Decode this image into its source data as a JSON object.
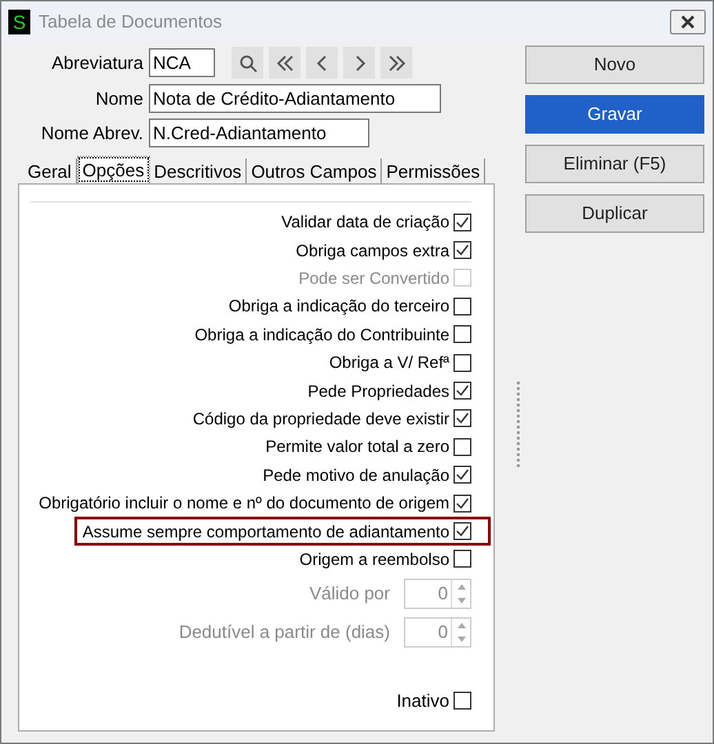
{
  "window": {
    "title": "Tabela de Documentos",
    "icon_glyph": "S"
  },
  "fields": [
    {
      "label": "Abreviatura",
      "value": "NCA",
      "kind": "short"
    },
    {
      "label": "Nome",
      "value": "Nota de Crédito-Adiantamento",
      "kind": "long"
    },
    {
      "label": "Nome Abrev.",
      "value": "N.Cred-Adiantamento",
      "kind": "medium"
    }
  ],
  "tabs": [
    {
      "label": "Geral",
      "selected": false
    },
    {
      "label": "Opções",
      "selected": true
    },
    {
      "label": "Descritivos",
      "selected": false
    },
    {
      "label": "Outros Campos",
      "selected": false
    },
    {
      "label": "Permissões",
      "selected": false
    }
  ],
  "options": [
    {
      "kind": "checkbox",
      "label": "Validar data de criação",
      "checked": true,
      "disabled": false,
      "highlighted": false
    },
    {
      "kind": "checkbox",
      "label": "Obriga campos extra",
      "checked": true,
      "disabled": false,
      "highlighted": false
    },
    {
      "kind": "checkbox",
      "label": "Pode ser Convertido",
      "checked": false,
      "disabled": true,
      "highlighted": false
    },
    {
      "kind": "checkbox",
      "label": "Obriga a indicação do terceiro",
      "checked": false,
      "disabled": false,
      "highlighted": false
    },
    {
      "kind": "checkbox",
      "label": "Obriga a indicação do Contribuinte",
      "checked": false,
      "disabled": false,
      "highlighted": false
    },
    {
      "kind": "checkbox",
      "label": "Obriga a V/ Refª",
      "checked": false,
      "disabled": false,
      "highlighted": false
    },
    {
      "kind": "checkbox",
      "label": "Pede Propriedades",
      "checked": true,
      "disabled": false,
      "highlighted": false
    },
    {
      "kind": "checkbox",
      "label": "Código da propriedade deve existir",
      "checked": true,
      "disabled": false,
      "highlighted": false
    },
    {
      "kind": "checkbox",
      "label": "Permite valor total a zero",
      "checked": false,
      "disabled": false,
      "highlighted": false
    },
    {
      "kind": "checkbox",
      "label": "Pede motivo de anulação",
      "checked": true,
      "disabled": false,
      "highlighted": false
    },
    {
      "kind": "checkbox",
      "label": "Obrigatório incluir o nome e nº do documento de origem",
      "checked": true,
      "disabled": false,
      "highlighted": false
    },
    {
      "kind": "checkbox",
      "label": "Assume sempre comportamento de adiantamento",
      "checked": true,
      "disabled": false,
      "highlighted": true
    },
    {
      "kind": "checkbox",
      "label": "Origem a reembolso",
      "checked": false,
      "disabled": false,
      "highlighted": false
    },
    {
      "kind": "spinner",
      "label": "Válido por",
      "value": "0",
      "disabled": true
    },
    {
      "kind": "spinner",
      "label": "Dedutível a partir de (dias)",
      "value": "0",
      "disabled": true
    }
  ],
  "inactive": {
    "label": "Inativo",
    "checked": false
  },
  "buttons": [
    {
      "label": "Novo",
      "primary": false
    },
    {
      "label": "Gravar",
      "primary": true
    },
    {
      "label": "Eliminar (F5)",
      "primary": false
    },
    {
      "label": "Duplicar",
      "primary": false
    }
  ]
}
